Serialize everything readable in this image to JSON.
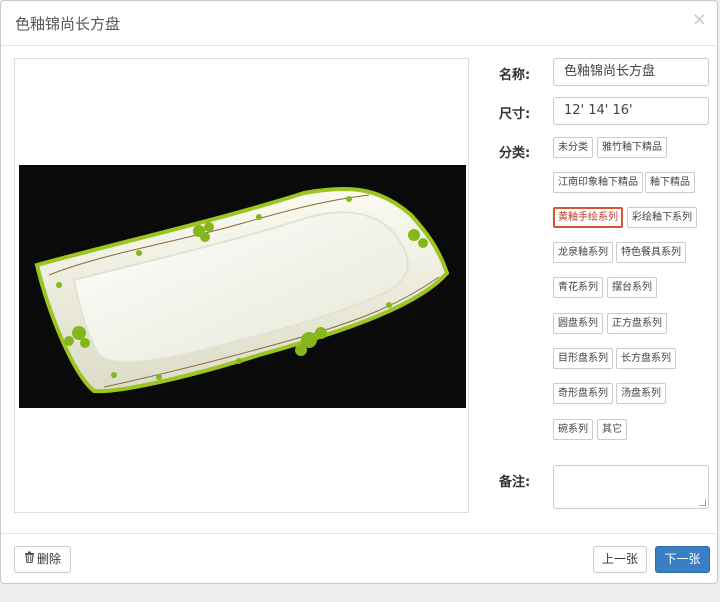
{
  "dialog": {
    "title": "色釉锦尚长方盘",
    "close_glyph": "×"
  },
  "image": {
    "alt": "色釉锦尚长方盘"
  },
  "form": {
    "name_label": "名称:",
    "name_value": "色釉锦尚长方盘",
    "size_label": "尺寸:",
    "size_value": "12' 14' 16'",
    "category_label": "分类:",
    "categories": [
      "未分类",
      "雅竹釉下精品",
      "江南印象釉下精品",
      "釉下精品",
      "黄釉手绘系列",
      "彩绘釉下系列",
      "龙泉釉系列",
      "特色餐具系列",
      "青花系列",
      "摆台系列",
      "圆盘系列",
      "正方盘系列",
      "目形盘系列",
      "长方盘系列",
      "奇形盘系列",
      "汤盘系列",
      "碗系列",
      "其它"
    ],
    "selected_category": "黄釉手绘系列",
    "remark_label": "备注:",
    "remark_value": ""
  },
  "footer": {
    "delete_label": "删除",
    "prev_label": "上一张",
    "next_label": "下一张"
  },
  "colors": {
    "primary": "#3a7fc4",
    "selected_border": "#d5572d"
  },
  "icons": {
    "delete": "trash-icon",
    "close": "close-icon"
  }
}
